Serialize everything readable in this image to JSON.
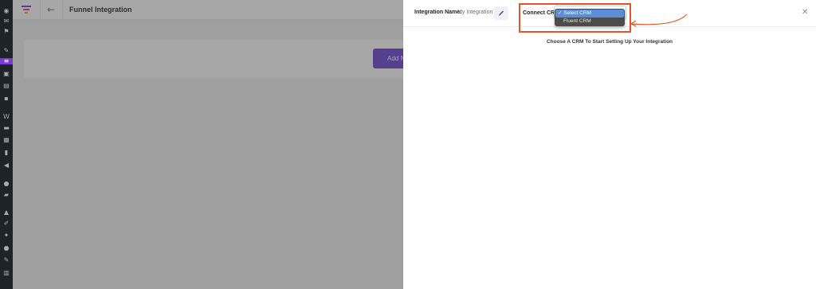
{
  "topbar": {
    "title": "Funnel Integration",
    "back_icon": "arrow-left-icon"
  },
  "content": {
    "add_new_label": "Add N"
  },
  "panel": {
    "integration_name_label": "Integration Name:",
    "integration_name_value": "My Integration",
    "connect_crm_label": "Connect CRM",
    "crm_options": [
      {
        "label": "✓ Select CRM",
        "selected": true
      },
      {
        "label": "Fluent CRM",
        "selected": false
      }
    ],
    "close_icon": "close-icon",
    "hint_text": "Choose A CRM To Start Setting Up Your Integration"
  },
  "colors": {
    "brand": "#6e42d3",
    "annotation": "#e2552b",
    "selected_option": "#5a8fd8"
  }
}
